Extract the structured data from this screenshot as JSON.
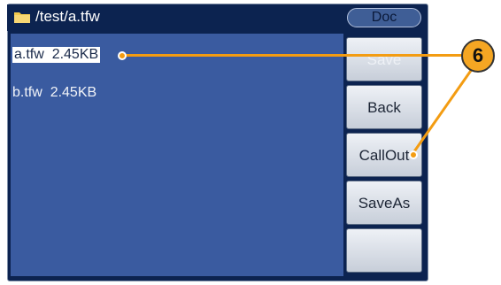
{
  "title_bar": {
    "path": "/test/a.tfw",
    "mode_label": "Doc"
  },
  "files": [
    {
      "name": "a.tfw",
      "size": "2.45KB"
    },
    {
      "name": "b.tfw",
      "size": "2.45KB"
    }
  ],
  "softkeys": [
    {
      "label": "Save",
      "enabled": false
    },
    {
      "label": "Back",
      "enabled": true
    },
    {
      "label": "CallOut",
      "enabled": true
    },
    {
      "label": "SaveAs",
      "enabled": true
    },
    {
      "label": "",
      "enabled": false
    }
  ],
  "callout": {
    "number": "6"
  },
  "colors": {
    "accent": "#f39c12",
    "screen_bg": "#0c2350",
    "panel_bg": "#3a5ba0"
  }
}
